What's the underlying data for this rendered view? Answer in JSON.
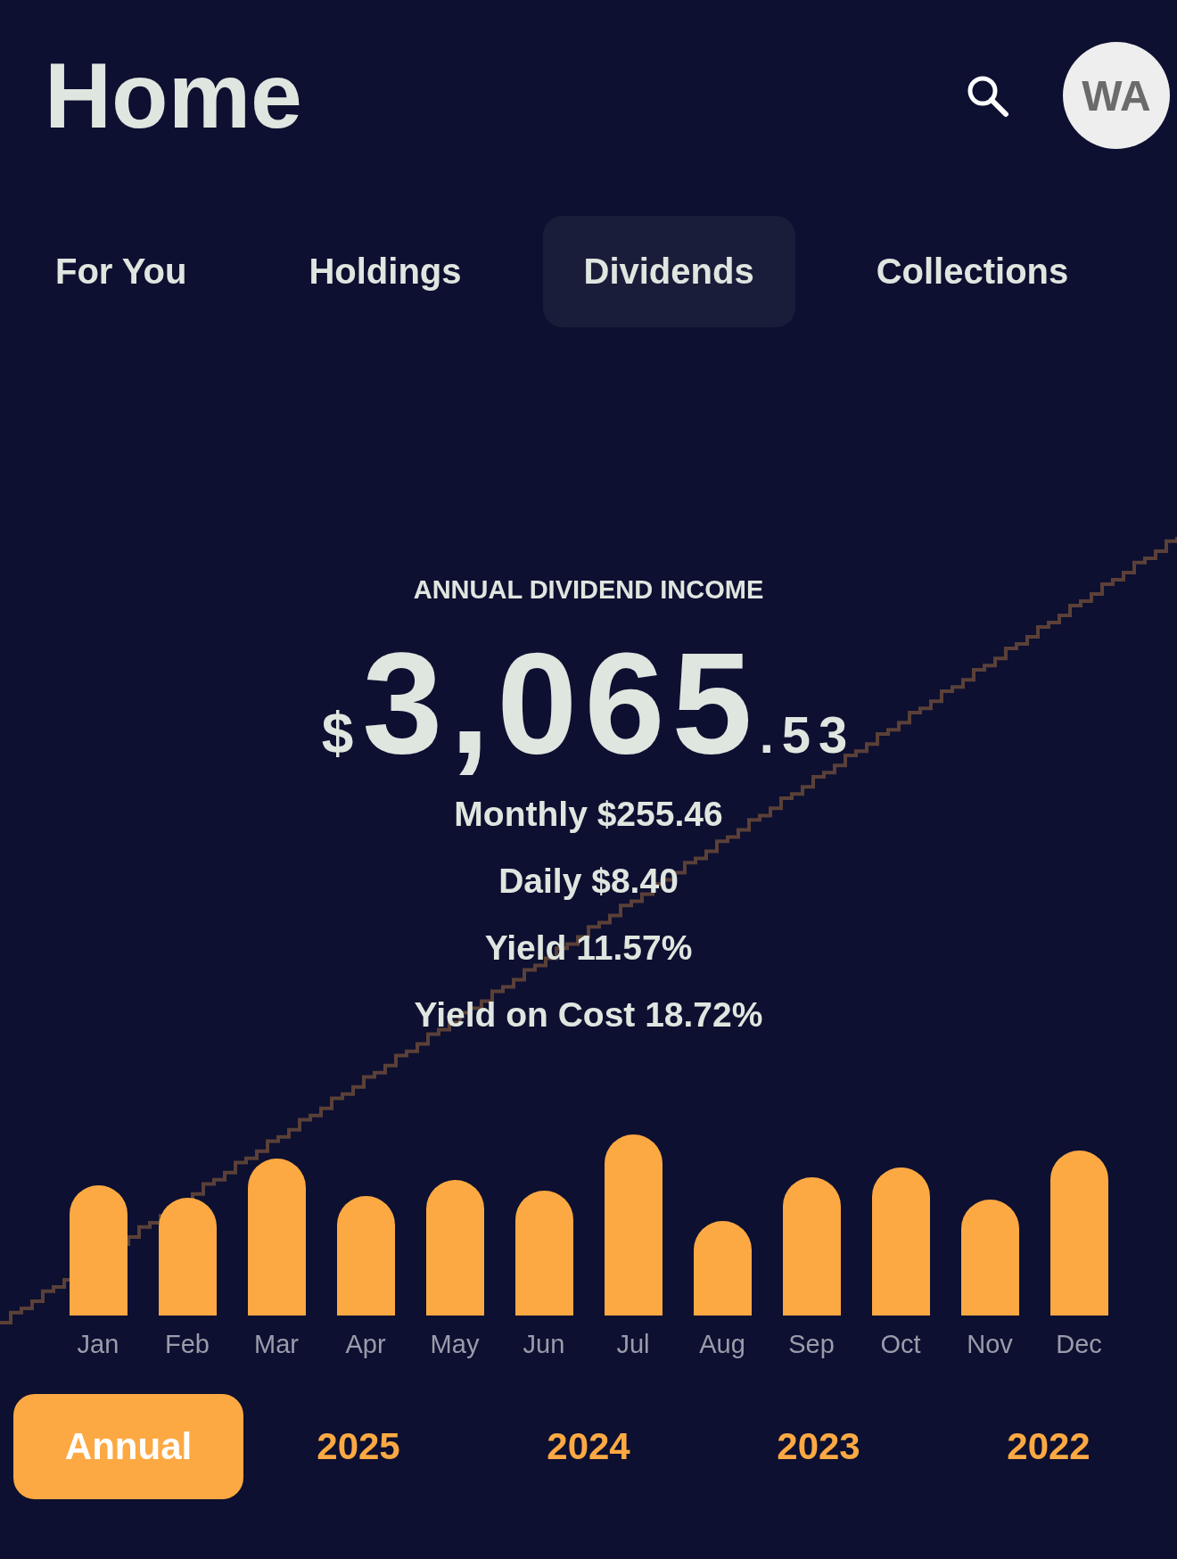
{
  "header": {
    "title": "Home",
    "avatar": "WA"
  },
  "tabs": [
    {
      "label": "For You",
      "selected": false
    },
    {
      "label": "Holdings",
      "selected": false
    },
    {
      "label": "Dividends",
      "selected": true
    },
    {
      "label": "Collections",
      "selected": false
    }
  ],
  "summary": {
    "label": "ANNUAL DIVIDEND INCOME",
    "currency": "$",
    "whole": "3,065",
    "cents": ".53",
    "stats": [
      "Monthly $255.46",
      "Daily $8.40",
      "Yield 11.57%",
      "Yield on Cost 18.72%"
    ]
  },
  "months": [
    "Jan",
    "Feb",
    "Mar",
    "Apr",
    "May",
    "Jun",
    "Jul",
    "Aug",
    "Sep",
    "Oct",
    "Nov",
    "Dec"
  ],
  "periods": [
    {
      "label": "Annual",
      "selected": true
    },
    {
      "label": "2025",
      "selected": false
    },
    {
      "label": "2024",
      "selected": false
    },
    {
      "label": "2023",
      "selected": false
    },
    {
      "label": "2022",
      "selected": false
    }
  ]
}
